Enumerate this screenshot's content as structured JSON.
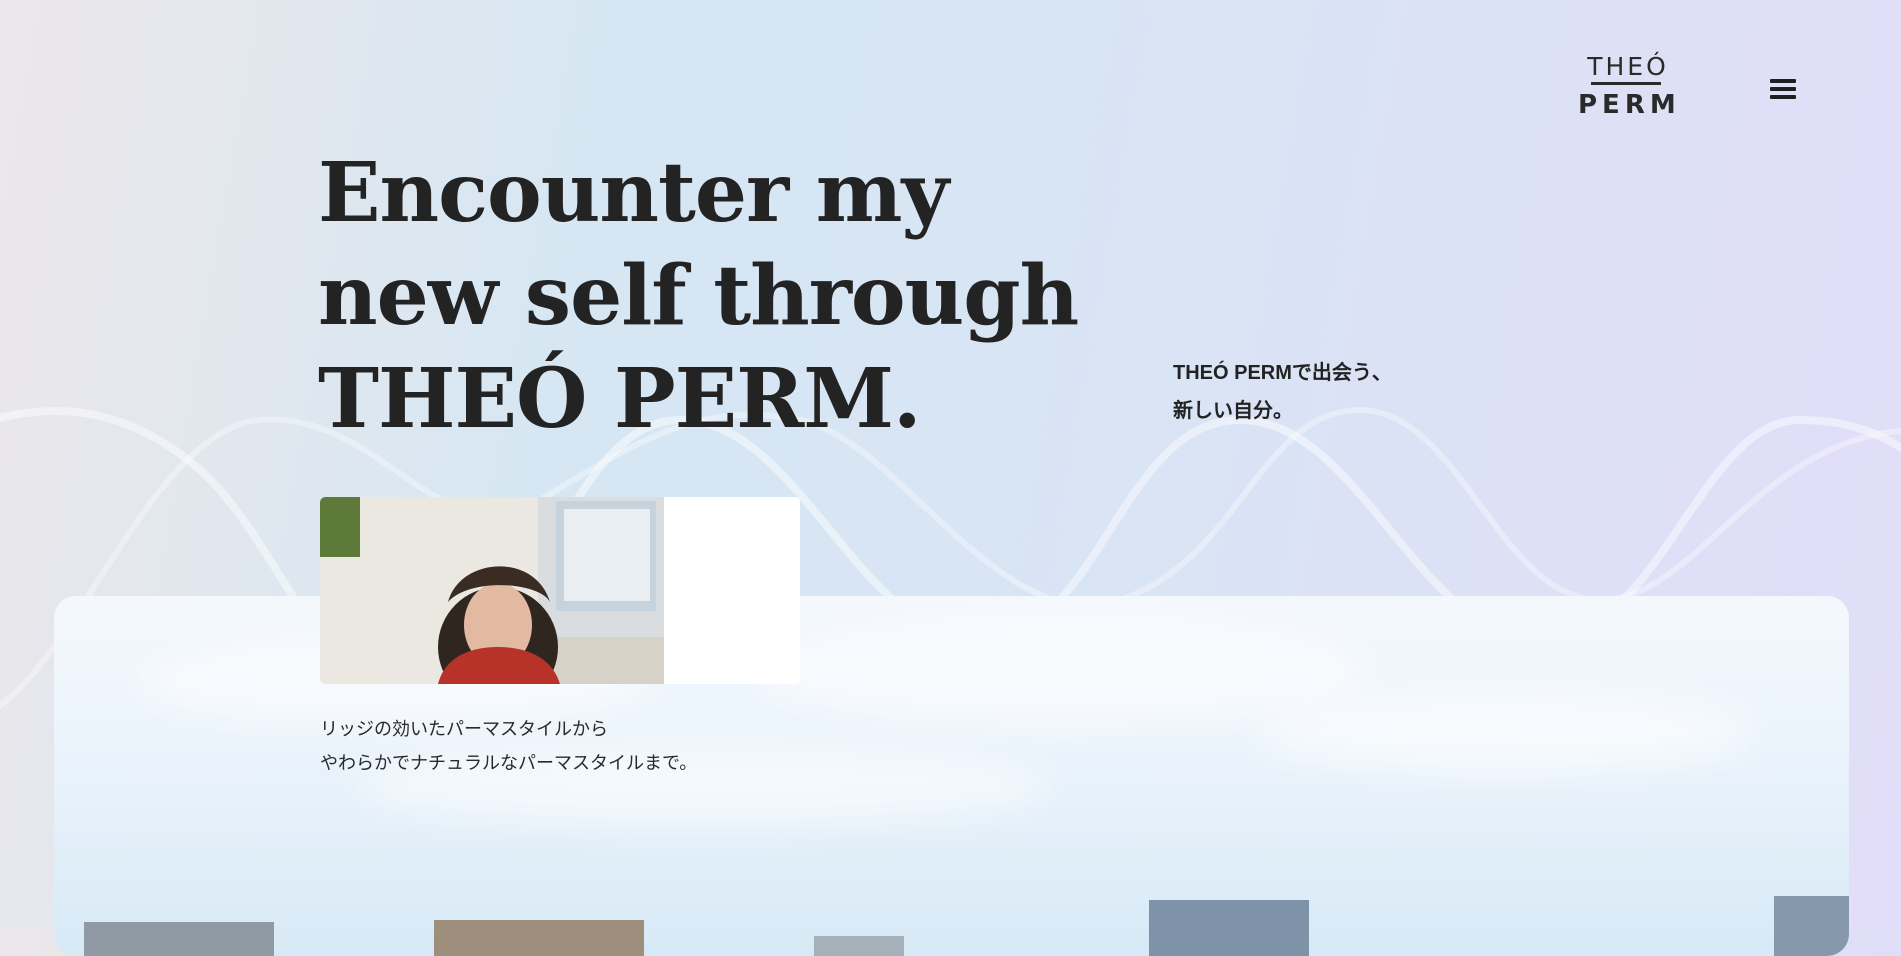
{
  "brand": {
    "logo_top": "THEÓ",
    "logo_bottom": "PERM"
  },
  "nav": {
    "menu_icon": "hamburger-menu-icon"
  },
  "hero": {
    "headline_lines": [
      "Encounter my",
      "new self through",
      "THEÓ PERM."
    ],
    "subcopy_lines": [
      "THEÓ PERMで出会う、",
      "新しい自分。"
    ],
    "description_lines": [
      "リッジの効いたパーマスタイルから",
      "やわらかでナチュラルなパーマスタイルまで。"
    ]
  },
  "colors": {
    "text": "#1f1f1f",
    "background_left": "#ece7ea",
    "background_mid": "#d6e7f3",
    "background_right": "#e2ddf8",
    "card": "#eef5fc"
  }
}
